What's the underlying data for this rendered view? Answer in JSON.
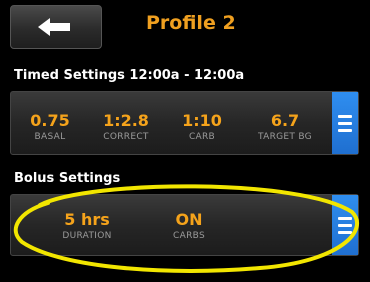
{
  "header": {
    "back_icon": "back-arrow-icon",
    "title": "Profile 2"
  },
  "timed_settings": {
    "label": "Timed Settings 12:00a - 12:00a",
    "items": [
      {
        "value": "0.75",
        "label": "BASAL"
      },
      {
        "value": "1:2.8",
        "label": "CORRECT"
      },
      {
        "value": "1:10",
        "label": "CARB"
      },
      {
        "value": "6.7",
        "label": "TARGET BG"
      }
    ],
    "menu_icon": "menu-icon"
  },
  "bolus_settings": {
    "label": "Bolus Settings",
    "items": [
      {
        "value": "5 hrs",
        "label": "DURATION"
      },
      {
        "value": "ON",
        "label": "CARBS"
      }
    ],
    "menu_icon": "menu-icon"
  },
  "colors": {
    "accent": "#f5a31b",
    "menu_button": "#1f6fd0",
    "highlight": "#f2e600"
  }
}
